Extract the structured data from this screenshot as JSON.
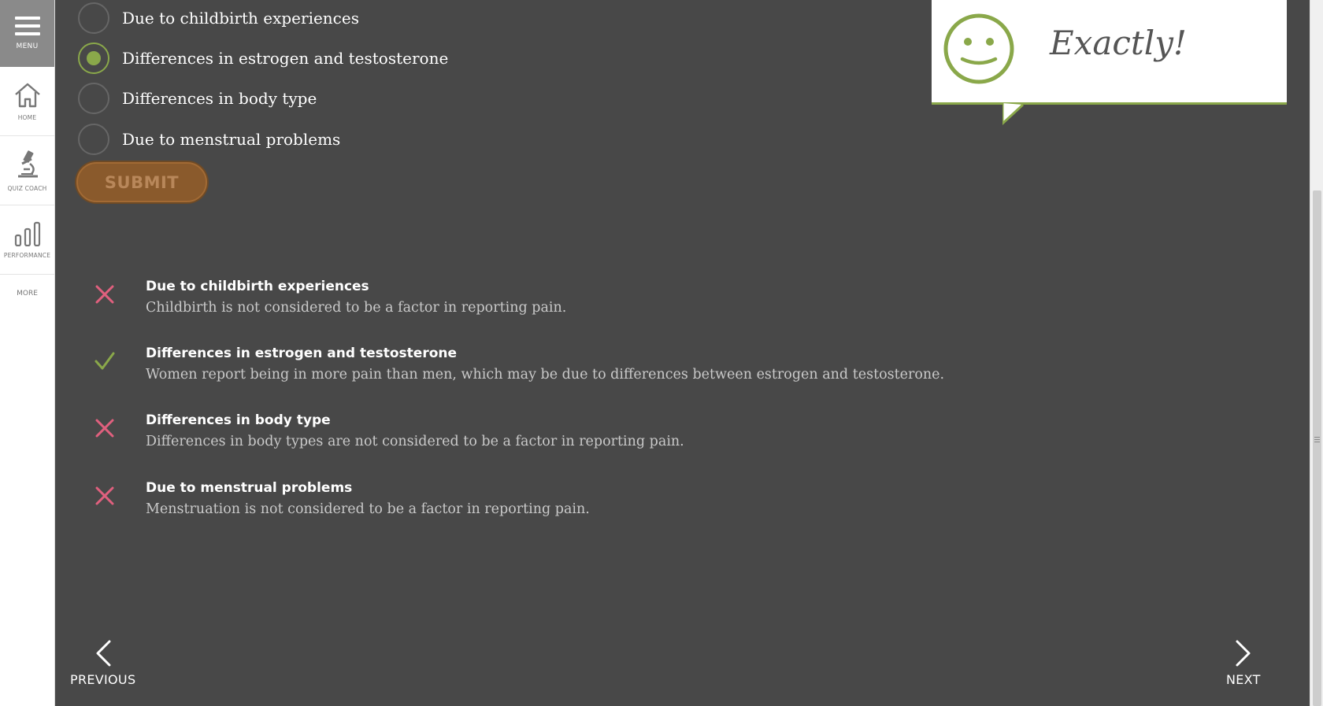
{
  "sidebar": {
    "menu_label": "MENU",
    "items": [
      {
        "label": "HOME",
        "icon": "home-icon"
      },
      {
        "label": "QUIZ COACH",
        "icon": "microscope-icon"
      },
      {
        "label": "PERFORMANCE",
        "icon": "bar-chart-icon"
      }
    ],
    "more_label": "MORE"
  },
  "quiz": {
    "options": [
      {
        "text": "Due to childbirth experiences",
        "selected": false
      },
      {
        "text": "Differences in estrogen and testosterone",
        "selected": true
      },
      {
        "text": "Differences in body type",
        "selected": false
      },
      {
        "text": "Due to menstrual problems",
        "selected": false
      }
    ],
    "submit_label": "SUBMIT"
  },
  "feedback": [
    {
      "title": "Due to childbirth experiences",
      "desc": "Childbirth is not considered to be a factor in reporting pain.",
      "correct": false
    },
    {
      "title": "Differences in estrogen and testosterone",
      "desc": "Women report being in more pain than men, which may be due to differences between estrogen and testosterone.",
      "correct": true
    },
    {
      "title": "Differences in body type",
      "desc": "Differences in body types are not considered to be a factor in reporting pain.",
      "correct": false
    },
    {
      "title": "Due to menstrual problems",
      "desc": "Menstruation is not considered to be a factor in reporting pain.",
      "correct": false
    }
  ],
  "bubble": {
    "text": "Exactly!"
  },
  "nav": {
    "previous": "PREVIOUS",
    "next": "NEXT"
  },
  "colors": {
    "accent": "#8aa84a",
    "wrong": "#e0607e",
    "submit": "#8a5a2c",
    "background": "#484848"
  }
}
